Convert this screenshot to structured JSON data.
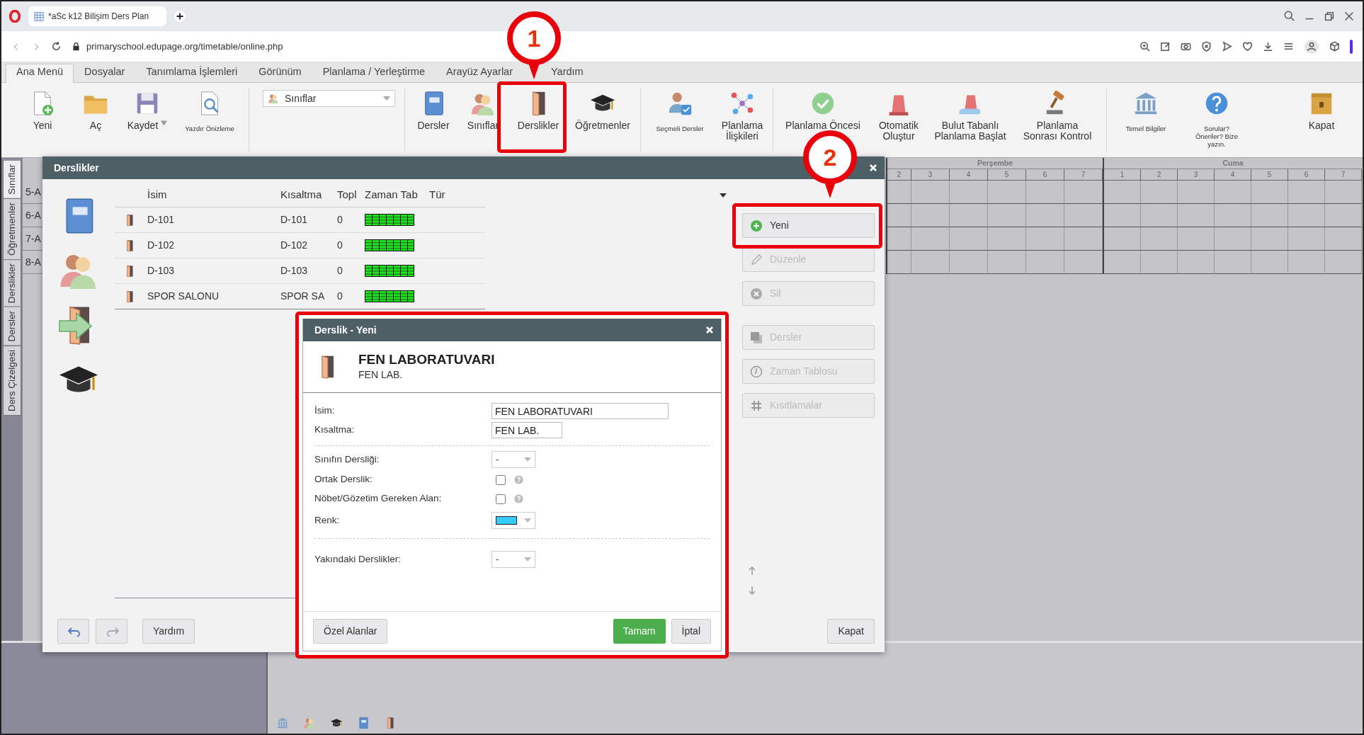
{
  "browser": {
    "tab_title": "*aSc k12 Bilişim Ders Plan",
    "url": "primaryschool.edupage.org/timetable/online.php"
  },
  "menu_tabs": [
    {
      "label": "Ana Menü",
      "selected": true
    },
    {
      "label": "Dosyalar",
      "selected": false
    },
    {
      "label": "Tanımlama İşlemleri",
      "selected": false
    },
    {
      "label": "Görünüm",
      "selected": false
    },
    {
      "label": "Planlama / Yerleştirme",
      "selected": false
    },
    {
      "label": "Arayüz Ayarlar",
      "selected": false
    },
    {
      "label": "Yardım",
      "selected": false
    }
  ],
  "toolbar_groups": [
    {
      "items": [
        {
          "kind": "button",
          "label": "Yeni"
        },
        {
          "kind": "button",
          "label": "Aç"
        },
        {
          "kind": "split_button",
          "label": "Kaydet"
        },
        {
          "kind": "small_button",
          "label": "Yazdır Önizleme"
        }
      ]
    },
    {
      "items": [
        {
          "kind": "dropdown",
          "value": "Sınıflar"
        }
      ]
    },
    {
      "items": [
        {
          "kind": "button",
          "label": "Dersler"
        },
        {
          "kind": "button",
          "label": "Sınıflar"
        },
        {
          "kind": "button",
          "label": "Derslikler"
        },
        {
          "kind": "button",
          "label": "Öğretmenler"
        }
      ]
    },
    {
      "items": [
        {
          "kind": "small_button",
          "label": "Seçmeli Dersler"
        },
        {
          "kind": "button",
          "label": "Planlama\nİlişkileri"
        }
      ]
    },
    {
      "items": [
        {
          "kind": "button",
          "label": "Planlama Öncesi"
        },
        {
          "kind": "button",
          "label": "Otomatik\nOluştur"
        },
        {
          "kind": "button",
          "label": "Bulut Tabanlı\nPlanlama Başlat"
        },
        {
          "kind": "button",
          "label": "Planlama\nSonrası Kontrol"
        }
      ]
    },
    {
      "items": [
        {
          "kind": "small_button",
          "label": "Temel Bilgiler"
        },
        {
          "kind": "small_button",
          "label": "Sorular?\nÖneriler? Bize\nyazın."
        }
      ]
    },
    {
      "items": [
        {
          "kind": "button",
          "label": "Kapat"
        }
      ]
    }
  ],
  "side_tabs": [
    {
      "label": "Sınıflar",
      "selected": true
    },
    {
      "label": "Öğretmenler",
      "selected": false
    },
    {
      "label": "Derslikler",
      "selected": false
    },
    {
      "label": "Dersler",
      "selected": false
    },
    {
      "label": "Ders Çizelgesi",
      "selected": false
    }
  ],
  "timetable": {
    "rows": [
      "5-A",
      "6-A",
      "7-A",
      "8-A"
    ],
    "days": [
      {
        "name": "Perşembe",
        "periods": [
          "2",
          "3",
          "4",
          "5",
          "6",
          "7"
        ]
      },
      {
        "name": "Cuma",
        "periods": [
          "1",
          "2",
          "3",
          "4",
          "5",
          "6",
          "7"
        ]
      }
    ]
  },
  "rooms_dialog": {
    "title": "Derslikler",
    "columns": [
      "İsim",
      "Kısaltma",
      "Topl",
      "Zaman Tab",
      "Tür"
    ],
    "rows": [
      {
        "name": "D-101",
        "short": "D-101",
        "total": "0"
      },
      {
        "name": "D-102",
        "short": "D-102",
        "total": "0"
      },
      {
        "name": "D-103",
        "short": "D-103",
        "total": "0"
      },
      {
        "name": "SPOR SALONU",
        "short": "SPOR SA",
        "total": "0"
      }
    ],
    "actions": [
      {
        "label": "Yeni",
        "disabled": false
      },
      {
        "label": "Düzenle",
        "disabled": true
      },
      {
        "label": "Sil",
        "disabled": true
      },
      {
        "label": "Dersler",
        "disabled": true
      },
      {
        "label": "Zaman Tablosu",
        "disabled": true
      },
      {
        "label": "Kısıtlamalar",
        "disabled": true
      }
    ],
    "undo": {
      "disabled": false
    },
    "redo": {
      "disabled": true
    },
    "help": "Yardım",
    "close": "Kapat"
  },
  "room_editor": {
    "title": "Derslik - Yeni",
    "heading": "FEN LABORATUVARI",
    "subheading": "FEN LAB.",
    "sections": [
      {
        "fields": [
          {
            "kind": "text",
            "label": "İsim:",
            "value": "FEN LABORATUVARI"
          },
          {
            "kind": "text",
            "label": "Kısaltma:",
            "value": "FEN LAB."
          }
        ]
      },
      {
        "fields": [
          {
            "kind": "select",
            "label": "Sınıfın Dersliği:",
            "value": "-"
          },
          {
            "kind": "checkbox",
            "label": "Ortak Derslik:",
            "checked": false
          },
          {
            "kind": "checkbox",
            "label": "Nöbet/Gözetim Gereken Alan:",
            "checked": false
          },
          {
            "kind": "color",
            "label": "Renk:",
            "color": "#33ccff"
          }
        ]
      },
      {
        "fields": [
          {
            "kind": "select",
            "label": "Yakındaki Derslikler:",
            "value": "-"
          }
        ]
      }
    ],
    "extra": "Özel Alanlar",
    "ok": "Tamam",
    "cancel": "İptal"
  },
  "callouts": [
    {
      "number": "1"
    },
    {
      "number": "2"
    }
  ]
}
